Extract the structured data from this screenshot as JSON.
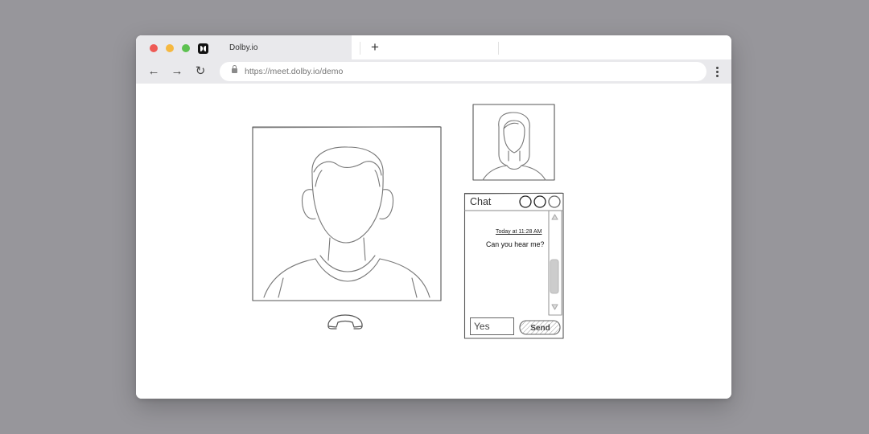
{
  "browser": {
    "tab_title": "Dolby.io",
    "new_tab_label": "+",
    "url": "https://meet.dolby.io/demo",
    "back_label": "←",
    "forward_label": "→",
    "reload_label": "↻"
  },
  "chat": {
    "title": "Chat",
    "messages": [
      {
        "timestamp": "Today at 11:28 AM",
        "text": "Can you hear me?"
      }
    ],
    "input_value": "Yes",
    "send_label": "Send"
  },
  "icons": {
    "favicon": "dolby-logo-icon",
    "lock": "lock-icon",
    "menu": "kebab-menu-icon",
    "hang_up": "phone-hang-up-icon"
  }
}
